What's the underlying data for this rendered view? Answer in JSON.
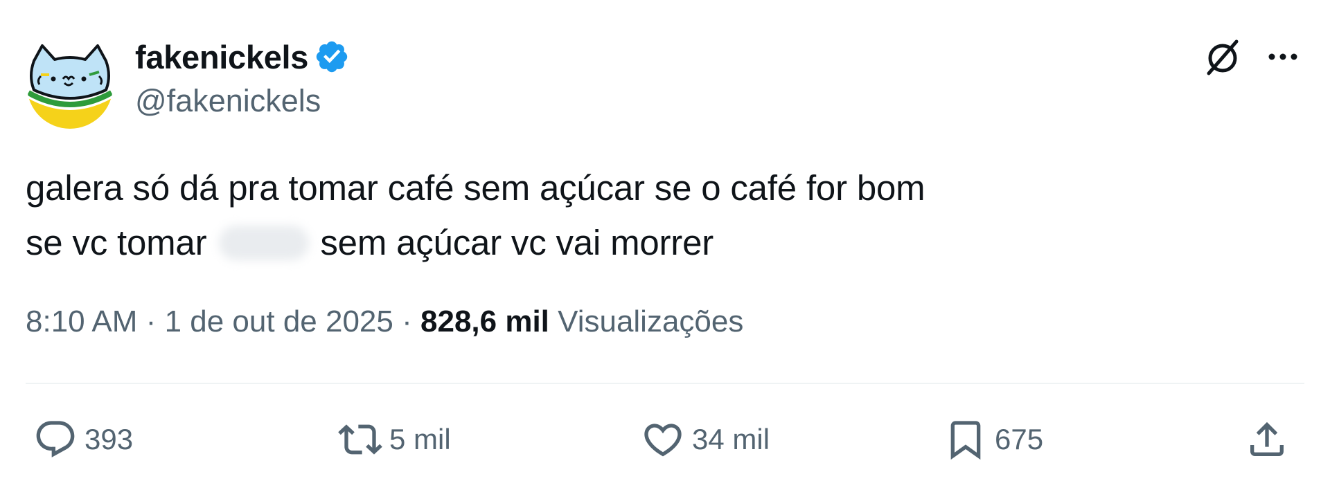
{
  "author": {
    "display_name": "fakenickels",
    "handle": "@fakenickels",
    "verified": true,
    "avatar_icon": "cat-avatar-icon"
  },
  "tweet": {
    "line1": "galera só dá pra tomar café sem açúcar se o café for bom",
    "line2_before": "se vc tomar",
    "line2_after": "sem açúcar vc vai morrer"
  },
  "meta": {
    "time": "8:10 AM",
    "separator": "·",
    "date": "1 de out de 2025",
    "views_count": "828,6 mil",
    "views_label": "Visualizações"
  },
  "actions": {
    "replies": "393",
    "reposts": "5 mil",
    "likes": "34 mil",
    "bookmarks": "675"
  },
  "colors": {
    "text_primary": "#0f1419",
    "text_secondary": "#536471",
    "verified_blue": "#1d9bf0",
    "divider": "#eff3f4"
  }
}
